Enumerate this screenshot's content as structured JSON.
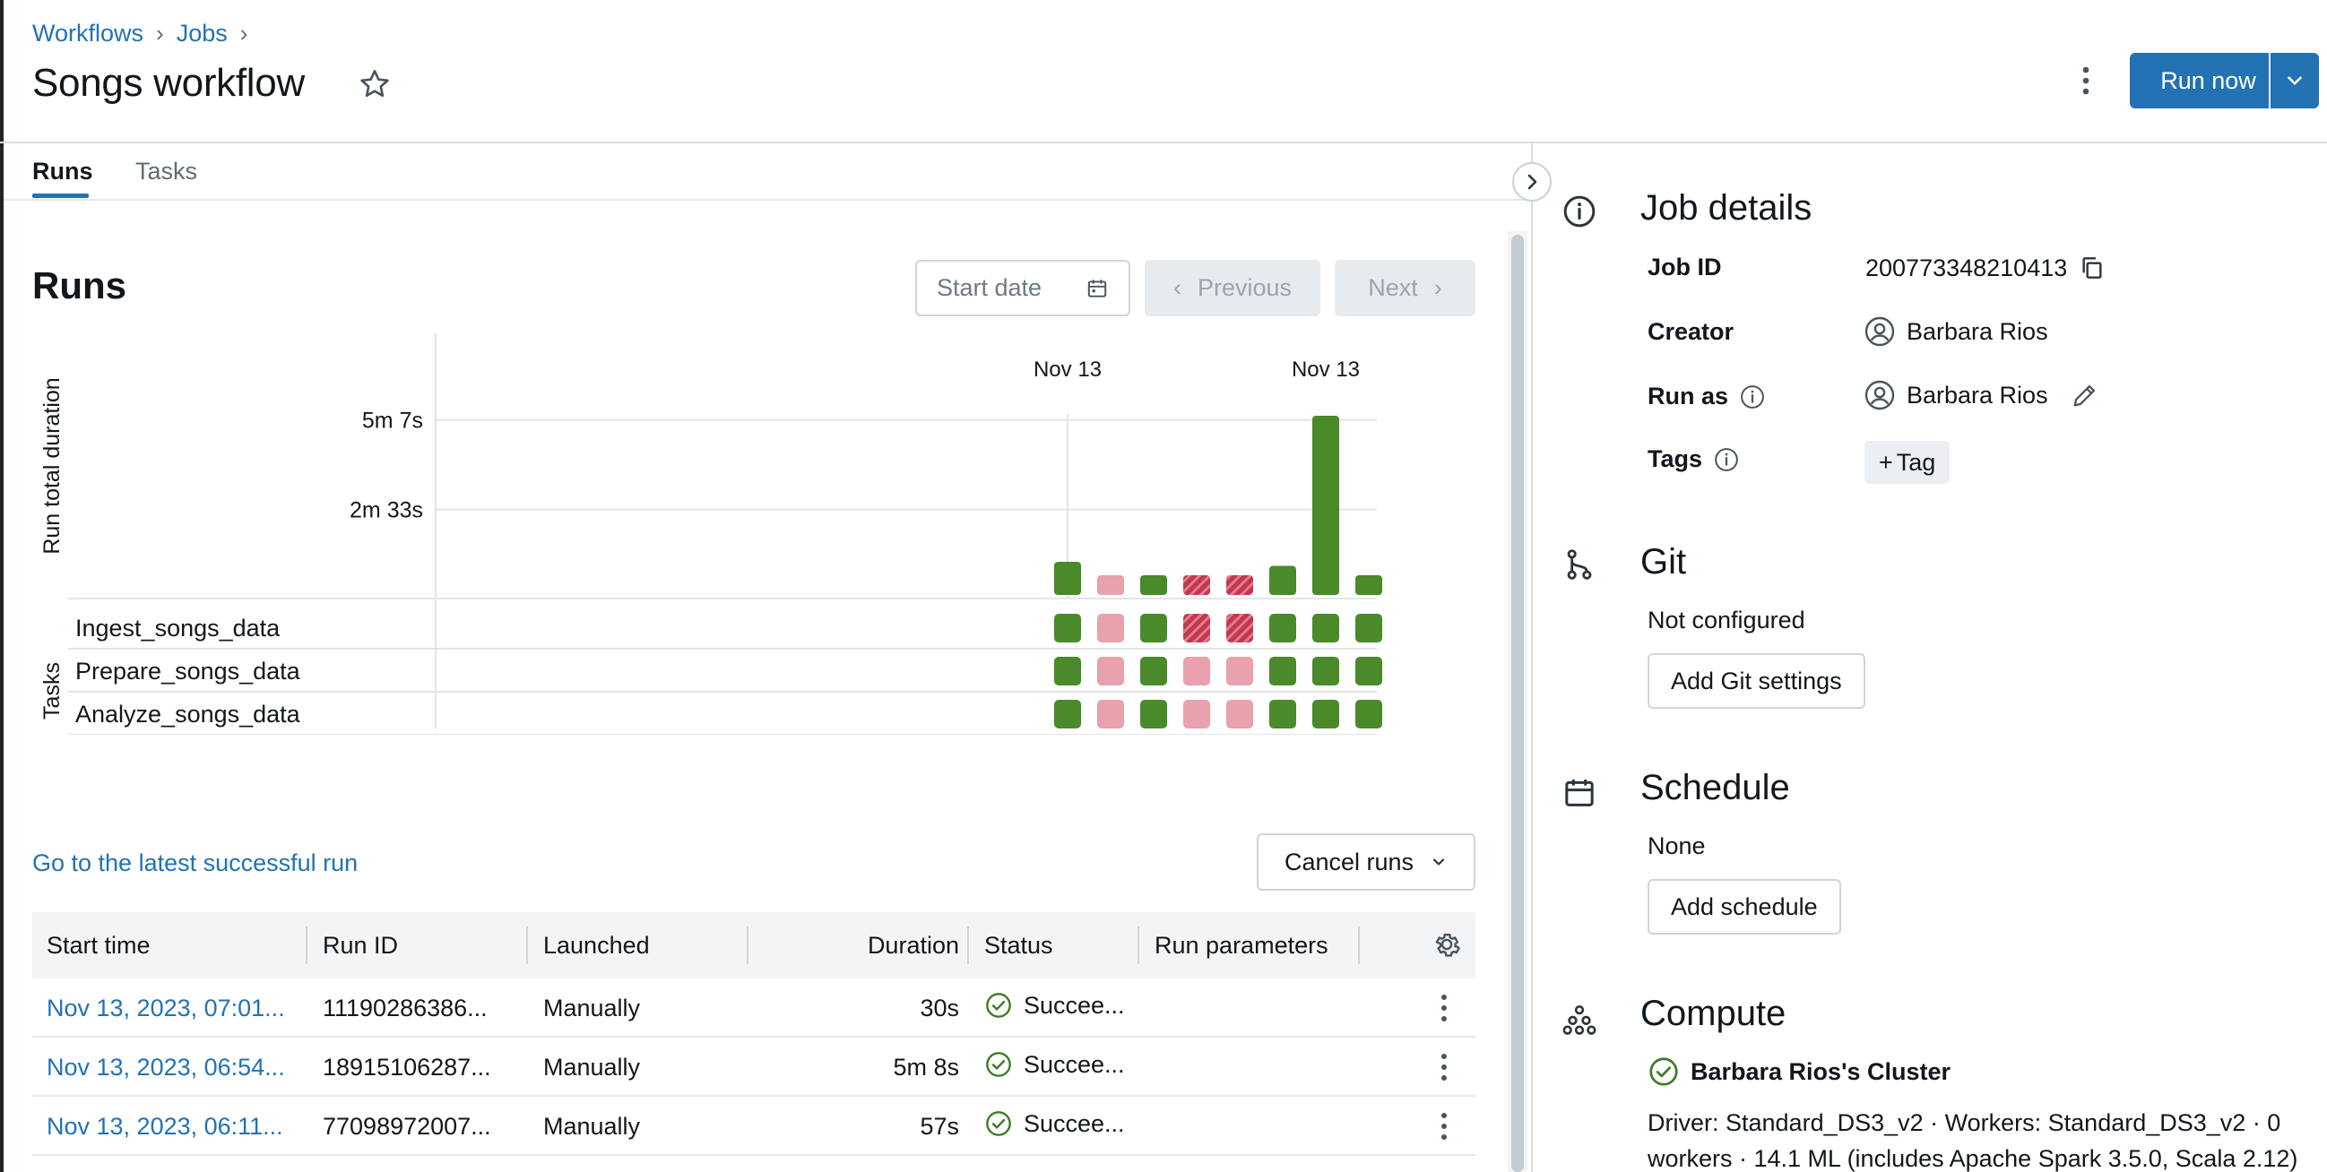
{
  "breadcrumb": {
    "items": [
      "Workflows",
      "Jobs"
    ]
  },
  "page": {
    "title": "Songs workflow"
  },
  "header": {
    "run_now_label": "Run now"
  },
  "tabs": [
    {
      "label": "Runs",
      "active": true
    },
    {
      "label": "Tasks",
      "active": false
    }
  ],
  "runs": {
    "title": "Runs",
    "start_date_placeholder": "Start date",
    "previous_label": "Previous",
    "next_label": "Next",
    "latest_successful_link": "Go to the latest successful run",
    "cancel_runs_label": "Cancel runs"
  },
  "chart_data": {
    "type": "bar",
    "ylabel": "Run total duration",
    "tasks_label": "Tasks",
    "date_labels": [
      "Nov 13",
      "Nov 13"
    ],
    "y_ticks": [
      "5m 7s",
      "2m 33s"
    ],
    "y_tick_seconds": [
      307,
      153
    ],
    "run_durations_seconds": [
      57,
      15,
      30,
      15,
      15,
      50,
      308,
      30
    ],
    "run_status": [
      "success",
      "canceled",
      "success",
      "failed",
      "failed",
      "success",
      "success",
      "success"
    ],
    "tasks": [
      {
        "name": "Ingest_songs_data",
        "statuses": [
          "success",
          "canceled",
          "success",
          "failed",
          "failed",
          "success",
          "success",
          "success"
        ]
      },
      {
        "name": "Prepare_songs_data",
        "statuses": [
          "success",
          "canceled",
          "success",
          "canceled",
          "canceled",
          "success",
          "success",
          "success"
        ]
      },
      {
        "name": "Analyze_songs_data",
        "statuses": [
          "success",
          "canceled",
          "success",
          "canceled",
          "canceled",
          "success",
          "success",
          "success"
        ]
      }
    ],
    "colors": {
      "success": "#4a8a2a",
      "canceled": "#e8a1ad",
      "failed": "#c4364f"
    }
  },
  "table": {
    "headers": [
      "Start time",
      "Run ID",
      "Launched",
      "Duration",
      "Status",
      "Run parameters"
    ],
    "rows": [
      {
        "start_time": "Nov 13, 2023, 07:01...",
        "run_id": "11190286386...",
        "launched": "Manually",
        "duration": "30s",
        "status": "Succee..."
      },
      {
        "start_time": "Nov 13, 2023, 06:54...",
        "run_id": "18915106287...",
        "launched": "Manually",
        "duration": "5m 8s",
        "status": "Succee..."
      },
      {
        "start_time": "Nov 13, 2023, 06:11...",
        "run_id": "77098972007...",
        "launched": "Manually",
        "duration": "57s",
        "status": "Succee..."
      }
    ]
  },
  "job_details": {
    "title": "Job details",
    "job_id_label": "Job ID",
    "job_id": "200773348210413",
    "creator_label": "Creator",
    "creator": "Barbara Rios",
    "run_as_label": "Run as",
    "run_as": "Barbara Rios",
    "tags_label": "Tags",
    "add_tag_label": "Tag"
  },
  "git": {
    "title": "Git",
    "status": "Not configured",
    "button": "Add Git settings"
  },
  "schedule": {
    "title": "Schedule",
    "value": "None",
    "button": "Add schedule"
  },
  "compute": {
    "title": "Compute",
    "cluster_name": "Barbara Rios's Cluster",
    "description": "Driver: Standard_DS3_v2 · Workers: Standard_DS3_v2 · 0 workers · 14.1 ML (includes Apache Spark 3.5.0, Scala 2.12)"
  }
}
